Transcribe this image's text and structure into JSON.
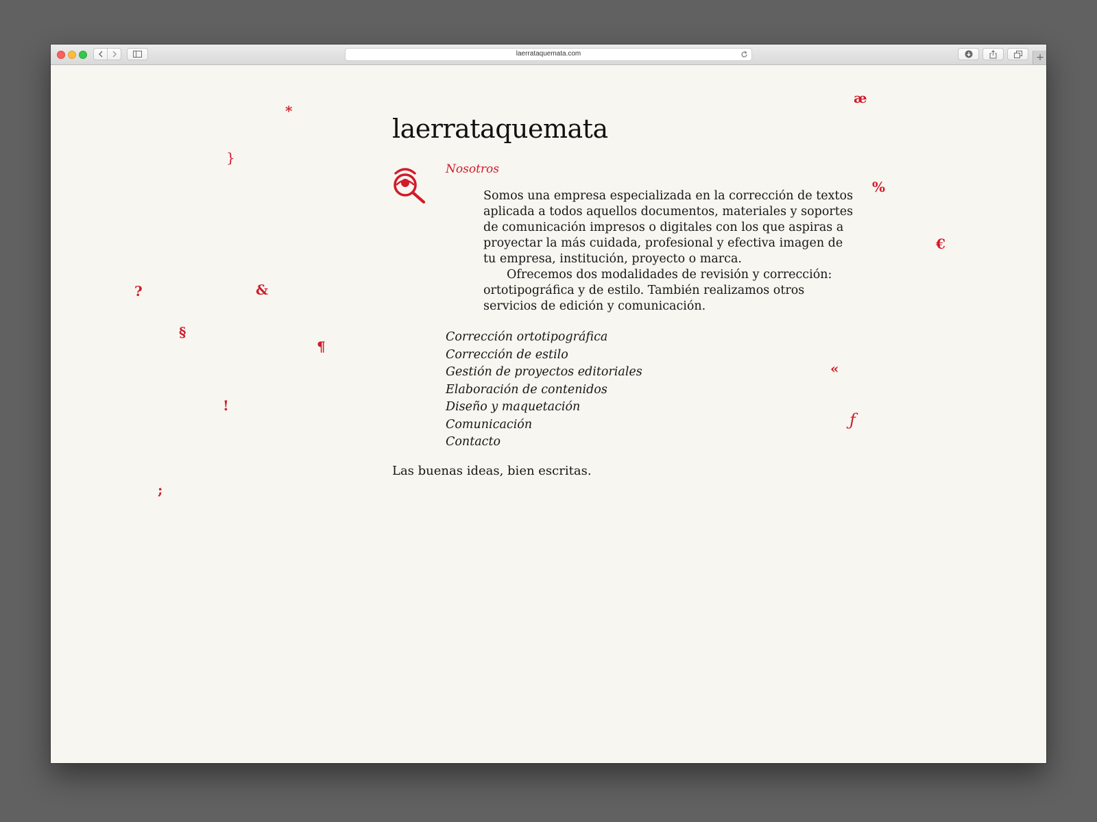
{
  "browser": {
    "url": "laerrataquemata.com"
  },
  "site": {
    "title": "laerrataquemata",
    "section_heading": "Nosotros",
    "about_paragraphs": [
      "Somos una empresa especializada en la corrección de textos aplicada a todos aquellos documentos, materiales y soportes de comunicación impresos o digitales con los que aspiras a proyectar la más cuidada, profesional y efectiva imagen de tu empresa, institución, proyecto o marca.",
      "Ofrecemos dos modalidades de revisión y corrección: ortotipográfica y de estilo. También realizamos otros servicios de edición y comunicación."
    ],
    "services": [
      "Corrección ortotipográfica",
      "Corrección de estilo",
      "Gestión de proyectos editoriales",
      "Elaboración de contenidos",
      "Diseño y maquetación",
      "Comunicación",
      "Contacto"
    ],
    "tagline": "Las buenas ideas, bien escritas."
  },
  "glyphs": {
    "asterisk": "*",
    "brace": "}",
    "question": "?",
    "ampersand": "&",
    "section": "§",
    "pilcrow": "¶",
    "exclamation": "!",
    "semicolon": ";",
    "ae": "æ",
    "percent": "%",
    "euro": "€",
    "guillemet": "«",
    "florin": "ƒ"
  },
  "colors": {
    "accent": "#d21a2a",
    "page_background": "#f7f6f0",
    "text": "#161616",
    "desktop": "#616161"
  },
  "icons": [
    "back-icon",
    "forward-icon",
    "sidebar-icon",
    "reload-icon",
    "download-icon",
    "share-icon",
    "tabs-icon",
    "new-tab-icon",
    "eye-magnifier-logo"
  ]
}
